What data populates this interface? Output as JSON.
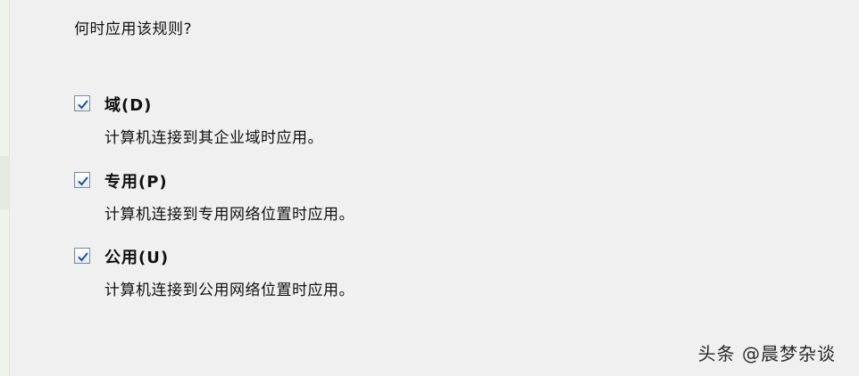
{
  "question": "何时应用该规则?",
  "options": [
    {
      "label": "域(D)",
      "description": "计算机连接到其企业域时应用。",
      "checked": true
    },
    {
      "label": "专用(P)",
      "description": "计算机连接到专用网络位置时应用。",
      "checked": true
    },
    {
      "label": "公用(U)",
      "description": "计算机连接到公用网络位置时应用。",
      "checked": true
    }
  ],
  "watermark": "头条 @晨梦杂谈",
  "colors": {
    "background": "#f0f0f0",
    "check": "#1f4fa0"
  },
  "icons": {
    "checkbox": "checkmark-icon"
  }
}
